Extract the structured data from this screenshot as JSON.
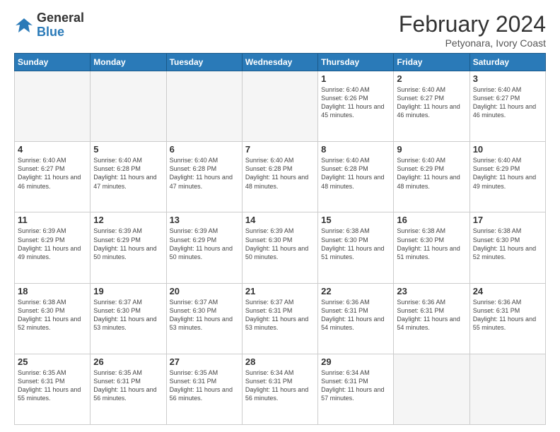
{
  "logo": {
    "general": "General",
    "blue": "Blue"
  },
  "header": {
    "title": "February 2024",
    "subtitle": "Petyonara, Ivory Coast"
  },
  "weekdays": [
    "Sunday",
    "Monday",
    "Tuesday",
    "Wednesday",
    "Thursday",
    "Friday",
    "Saturday"
  ],
  "days": [
    {
      "date": null,
      "info": ""
    },
    {
      "date": null,
      "info": ""
    },
    {
      "date": null,
      "info": ""
    },
    {
      "date": null,
      "info": ""
    },
    {
      "date": "1",
      "info": "Sunrise: 6:40 AM\nSunset: 6:26 PM\nDaylight: 11 hours and 45 minutes."
    },
    {
      "date": "2",
      "info": "Sunrise: 6:40 AM\nSunset: 6:27 PM\nDaylight: 11 hours and 46 minutes."
    },
    {
      "date": "3",
      "info": "Sunrise: 6:40 AM\nSunset: 6:27 PM\nDaylight: 11 hours and 46 minutes."
    },
    {
      "date": "4",
      "info": "Sunrise: 6:40 AM\nSunset: 6:27 PM\nDaylight: 11 hours and 46 minutes."
    },
    {
      "date": "5",
      "info": "Sunrise: 6:40 AM\nSunset: 6:28 PM\nDaylight: 11 hours and 47 minutes."
    },
    {
      "date": "6",
      "info": "Sunrise: 6:40 AM\nSunset: 6:28 PM\nDaylight: 11 hours and 47 minutes."
    },
    {
      "date": "7",
      "info": "Sunrise: 6:40 AM\nSunset: 6:28 PM\nDaylight: 11 hours and 48 minutes."
    },
    {
      "date": "8",
      "info": "Sunrise: 6:40 AM\nSunset: 6:28 PM\nDaylight: 11 hours and 48 minutes."
    },
    {
      "date": "9",
      "info": "Sunrise: 6:40 AM\nSunset: 6:29 PM\nDaylight: 11 hours and 48 minutes."
    },
    {
      "date": "10",
      "info": "Sunrise: 6:40 AM\nSunset: 6:29 PM\nDaylight: 11 hours and 49 minutes."
    },
    {
      "date": "11",
      "info": "Sunrise: 6:39 AM\nSunset: 6:29 PM\nDaylight: 11 hours and 49 minutes."
    },
    {
      "date": "12",
      "info": "Sunrise: 6:39 AM\nSunset: 6:29 PM\nDaylight: 11 hours and 50 minutes."
    },
    {
      "date": "13",
      "info": "Sunrise: 6:39 AM\nSunset: 6:29 PM\nDaylight: 11 hours and 50 minutes."
    },
    {
      "date": "14",
      "info": "Sunrise: 6:39 AM\nSunset: 6:30 PM\nDaylight: 11 hours and 50 minutes."
    },
    {
      "date": "15",
      "info": "Sunrise: 6:38 AM\nSunset: 6:30 PM\nDaylight: 11 hours and 51 minutes."
    },
    {
      "date": "16",
      "info": "Sunrise: 6:38 AM\nSunset: 6:30 PM\nDaylight: 11 hours and 51 minutes."
    },
    {
      "date": "17",
      "info": "Sunrise: 6:38 AM\nSunset: 6:30 PM\nDaylight: 11 hours and 52 minutes."
    },
    {
      "date": "18",
      "info": "Sunrise: 6:38 AM\nSunset: 6:30 PM\nDaylight: 11 hours and 52 minutes."
    },
    {
      "date": "19",
      "info": "Sunrise: 6:37 AM\nSunset: 6:30 PM\nDaylight: 11 hours and 53 minutes."
    },
    {
      "date": "20",
      "info": "Sunrise: 6:37 AM\nSunset: 6:30 PM\nDaylight: 11 hours and 53 minutes."
    },
    {
      "date": "21",
      "info": "Sunrise: 6:37 AM\nSunset: 6:31 PM\nDaylight: 11 hours and 53 minutes."
    },
    {
      "date": "22",
      "info": "Sunrise: 6:36 AM\nSunset: 6:31 PM\nDaylight: 11 hours and 54 minutes."
    },
    {
      "date": "23",
      "info": "Sunrise: 6:36 AM\nSunset: 6:31 PM\nDaylight: 11 hours and 54 minutes."
    },
    {
      "date": "24",
      "info": "Sunrise: 6:36 AM\nSunset: 6:31 PM\nDaylight: 11 hours and 55 minutes."
    },
    {
      "date": "25",
      "info": "Sunrise: 6:35 AM\nSunset: 6:31 PM\nDaylight: 11 hours and 55 minutes."
    },
    {
      "date": "26",
      "info": "Sunrise: 6:35 AM\nSunset: 6:31 PM\nDaylight: 11 hours and 56 minutes."
    },
    {
      "date": "27",
      "info": "Sunrise: 6:35 AM\nSunset: 6:31 PM\nDaylight: 11 hours and 56 minutes."
    },
    {
      "date": "28",
      "info": "Sunrise: 6:34 AM\nSunset: 6:31 PM\nDaylight: 11 hours and 56 minutes."
    },
    {
      "date": "29",
      "info": "Sunrise: 6:34 AM\nSunset: 6:31 PM\nDaylight: 11 hours and 57 minutes."
    },
    {
      "date": null,
      "info": ""
    },
    {
      "date": null,
      "info": ""
    }
  ]
}
